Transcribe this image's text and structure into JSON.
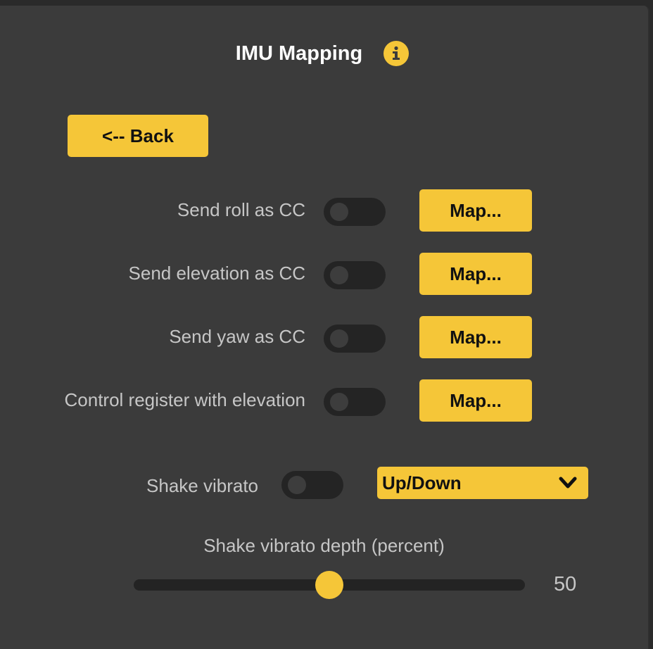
{
  "header": {
    "title": "IMU Mapping"
  },
  "colors": {
    "accent": "#f5c638",
    "panel_bg": "#3b3b3b",
    "label_text": "#c6c6c6",
    "toggle_off_bg": "#242424"
  },
  "icons": {
    "info": "info-icon",
    "dropdown": "chevron-down-icon"
  },
  "back_button": {
    "label": "<-- Back"
  },
  "mappings": [
    {
      "label": "Send roll as CC",
      "enabled": false,
      "button_label": "Map..."
    },
    {
      "label": "Send elevation as CC",
      "enabled": false,
      "button_label": "Map..."
    },
    {
      "label": "Send yaw as CC",
      "enabled": false,
      "button_label": "Map..."
    },
    {
      "label": "Control register with elevation",
      "enabled": false,
      "button_label": "Map..."
    }
  ],
  "shake_vibrato": {
    "label": "Shake vibrato",
    "enabled": false,
    "direction_selected": "Up/Down"
  },
  "shake_depth": {
    "label": "Shake vibrato depth (percent)",
    "value": "50",
    "min": 0,
    "max": 100
  }
}
